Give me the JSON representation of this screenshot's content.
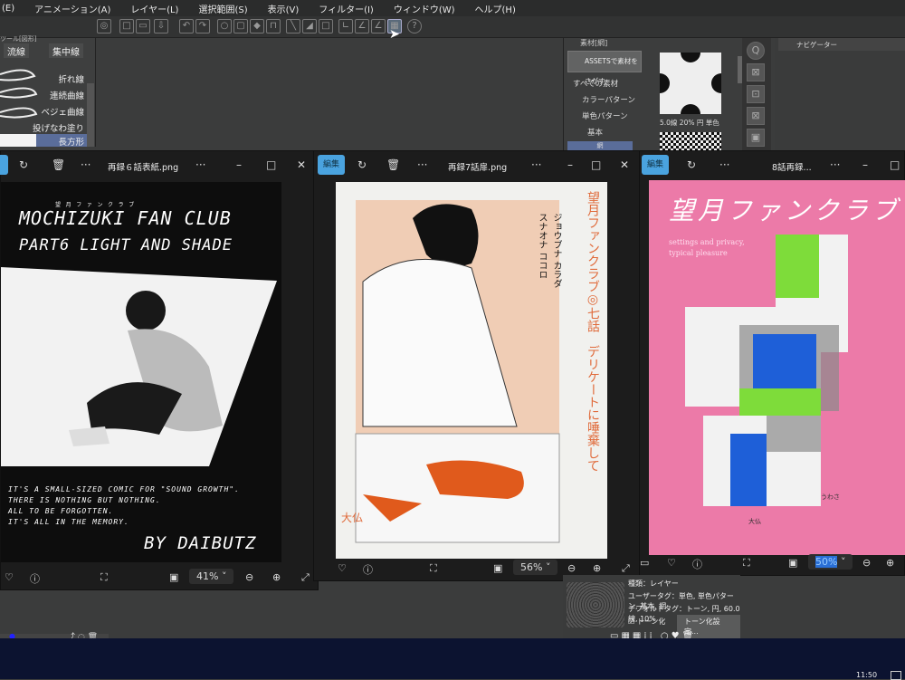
{
  "menubar": {
    "items": [
      "(E)",
      "アニメーション(A)",
      "レイヤー(L)",
      "選択範囲(S)",
      "表示(V)",
      "フィルター(I)",
      "ウィンドウ(W)",
      "ヘルプ(H)"
    ]
  },
  "tool_panel": {
    "header": "ツール[図形]",
    "tabs": [
      "流線",
      "集中線"
    ],
    "items": [
      "折れ線",
      "連続曲線",
      "ベジェ曲線",
      "投げなわ塗り",
      "長方形"
    ]
  },
  "assets_panel": {
    "title": "素材[網]",
    "search_button": "ASSETSで素材をさがす",
    "tree": [
      "すべての素材",
      "カラーパターン",
      "単色パターン",
      "基本",
      "網"
    ],
    "thumb_caption": "5.0線 20% 円 単色"
  },
  "navigator": {
    "title": "ナビゲーター"
  },
  "windows": [
    {
      "filename": "再録６話表紙.png",
      "zoom": "41%",
      "art": {
        "title_ruby": "望 月 フ ァ ン ク ラ ブ",
        "title1": "MOCHIZUKI FAN CLUB",
        "title2": "PART6 LIGHT AND SHADE",
        "lines": [
          "IT'S A SMALL-SIZED COMIC FOR \"SOUND GROWTH\".",
          "THERE IS NOTHING BUT NOTHING.",
          "ALL TO BE FORGOTTEN.",
          "IT'S ALL IN THE MEMORY."
        ],
        "byline": "BY DAIBUTZ"
      }
    },
    {
      "filename": "再録7話扉.png",
      "zoom": "56%",
      "edit_label": "編集",
      "art": {
        "vertical_title": "望月ファンクラブ◎七話　デリケートに唾棄して",
        "vertical_sub1": "ジョウブナ カラダ",
        "vertical_sub2": "スナオナ ココロ",
        "signature": "大仏"
      }
    },
    {
      "filename": "8話再録...",
      "zoom": "50%",
      "edit_label": "編集",
      "art": {
        "title": "望月ファンクラブ",
        "subtitle1": "settings and privacy,",
        "subtitle2": "typical pleasure",
        "credit": "うわさ",
        "signature": "大仏"
      }
    }
  ],
  "layer_props": {
    "line1": "種類：レイヤー",
    "line2": "ユーザータグ：単色, 単色パターン, 基本, 網",
    "line3": "デフォルトタグ：トーン, 円, 60.0線, 10%",
    "tone_checkbox": "トーン化",
    "tone_settings_button": "トーン化設定..."
  },
  "taskbar": {
    "time": "11:50"
  }
}
